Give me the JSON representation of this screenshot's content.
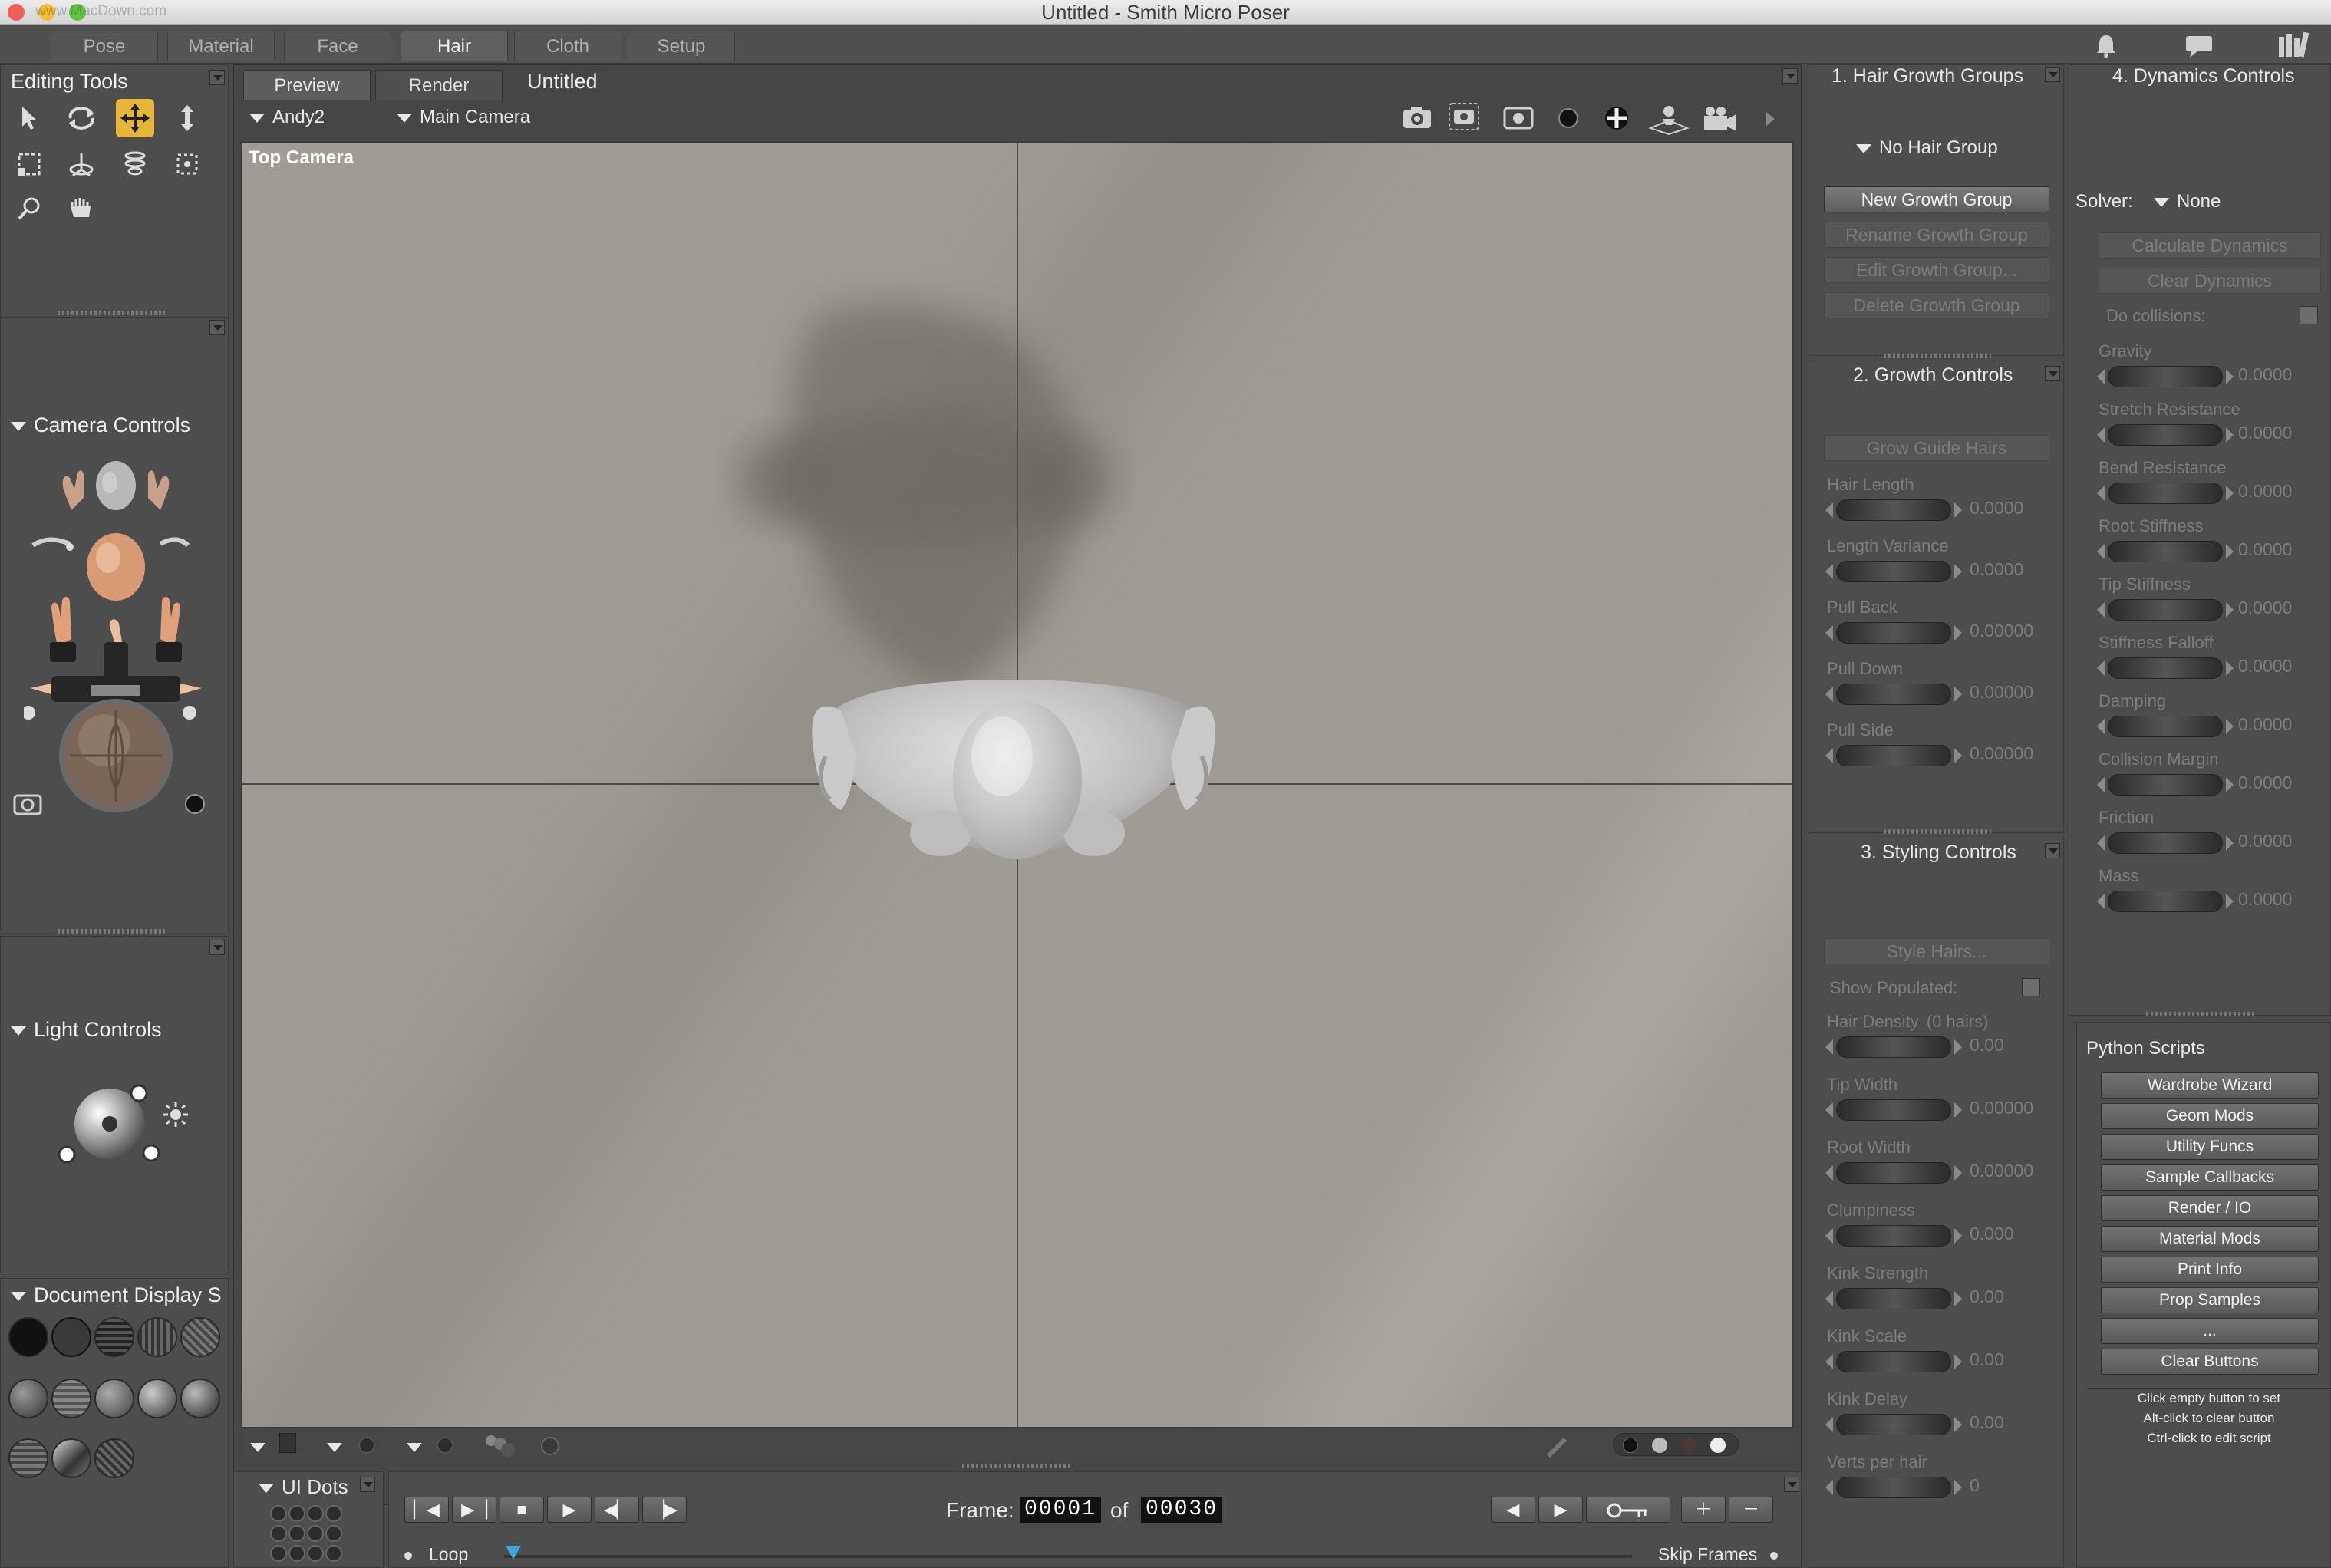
{
  "window": {
    "title": "Untitled - Smith Micro Poser",
    "watermark": "www.MacDown.com"
  },
  "colors": {
    "accent": "#e7b53a",
    "viewport_bg": "#9f9c95",
    "panel_bg": "#4d4d4d"
  },
  "rooms": {
    "tabs": [
      {
        "label": "Pose"
      },
      {
        "label": "Material"
      },
      {
        "label": "Face"
      },
      {
        "label": "Hair",
        "active": true
      },
      {
        "label": "Cloth"
      },
      {
        "label": "Setup"
      }
    ]
  },
  "editing_tools": {
    "title": "Editing Tools",
    "tools": [
      "select-arrow-icon",
      "rotate-icon",
      "translate-icon",
      "translate-in-out-icon",
      "scale-icon",
      "twist-icon",
      "taper-icon",
      "chain-break-icon",
      "zoom-icon",
      "grab-hand-icon"
    ]
  },
  "camera_controls": {
    "title": "Camera Controls"
  },
  "light_controls": {
    "title": "Light Controls"
  },
  "document_display": {
    "title": "Document Display S"
  },
  "ui_dots": {
    "title": "UI Dots"
  },
  "document": {
    "tabs": [
      {
        "label": "Preview",
        "active": true
      },
      {
        "label": "Render"
      }
    ],
    "doc_title": "Untitled",
    "figure_menu": "Andy2",
    "camera_menu": "Main Camera",
    "viewport_label": "Top Camera"
  },
  "hair_growth_groups": {
    "title": "1. Hair Growth Groups",
    "group_menu": "No Hair Group",
    "buttons": [
      {
        "label": "New Growth Group",
        "enabled": true
      },
      {
        "label": "Rename Growth Group",
        "enabled": false
      },
      {
        "label": "Edit Growth Group...",
        "enabled": false
      },
      {
        "label": "Delete Growth Group",
        "enabled": false
      }
    ]
  },
  "growth_controls": {
    "title": "2. Growth Controls",
    "button": "Grow Guide Hairs",
    "params": [
      {
        "label": "Hair Length",
        "value": "0.0000"
      },
      {
        "label": "Length Variance",
        "value": "0.0000"
      },
      {
        "label": "Pull Back",
        "value": "0.00000"
      },
      {
        "label": "Pull Down",
        "value": "0.00000"
      },
      {
        "label": "Pull Side",
        "value": "0.00000"
      }
    ]
  },
  "styling_controls": {
    "title": "3. Styling Controls",
    "button": "Style Hairs...",
    "show_populated": "Show Populated:",
    "params": [
      {
        "label": "Hair Density",
        "note": "(0 hairs)",
        "value": "0.00"
      },
      {
        "label": "Tip Width",
        "value": "0.00000"
      },
      {
        "label": "Root Width",
        "value": "0.00000"
      },
      {
        "label": "Clumpiness",
        "value": "0.000"
      },
      {
        "label": "Kink Strength",
        "value": "0.00"
      },
      {
        "label": "Kink Scale",
        "value": "0.00"
      },
      {
        "label": "Kink Delay",
        "value": "0.00"
      },
      {
        "label": "Verts per hair",
        "value": "0"
      }
    ]
  },
  "dynamics_controls": {
    "title": "4. Dynamics Controls",
    "solver_label": "Solver:",
    "solver_value": "None",
    "buttons": [
      "Calculate Dynamics",
      "Clear Dynamics"
    ],
    "do_collisions": "Do collisions:",
    "params": [
      {
        "label": "Gravity",
        "value": "0.0000"
      },
      {
        "label": "Stretch Resistance",
        "value": "0.0000"
      },
      {
        "label": "Bend Resistance",
        "value": "0.0000"
      },
      {
        "label": "Root Stiffness",
        "value": "0.0000"
      },
      {
        "label": "Tip Stiffness",
        "value": "0.0000"
      },
      {
        "label": "Stiffness Falloff",
        "value": "0.0000"
      },
      {
        "label": "Damping",
        "value": "0.0000"
      },
      {
        "label": "Collision Margin",
        "value": "0.0000"
      },
      {
        "label": "Friction",
        "value": "0.0000"
      },
      {
        "label": "Mass",
        "value": "0.0000"
      }
    ]
  },
  "python_scripts": {
    "title": "Python Scripts",
    "buttons": [
      "Wardrobe Wizard",
      "Geom Mods",
      "Utility Funcs",
      "Sample Callbacks",
      "Render / IO",
      "Material Mods",
      "Print Info",
      "Prop Samples",
      "...",
      "Clear Buttons"
    ],
    "help": [
      "Click empty button to set",
      "Alt-click to clear button",
      "Ctrl-click to edit script"
    ]
  },
  "animation": {
    "frame_label": "Frame:",
    "current_frame": "00001",
    "of_label": "of",
    "total_frames": "00030",
    "loop_label": "Loop",
    "skip_frames_label": "Skip Frames"
  }
}
